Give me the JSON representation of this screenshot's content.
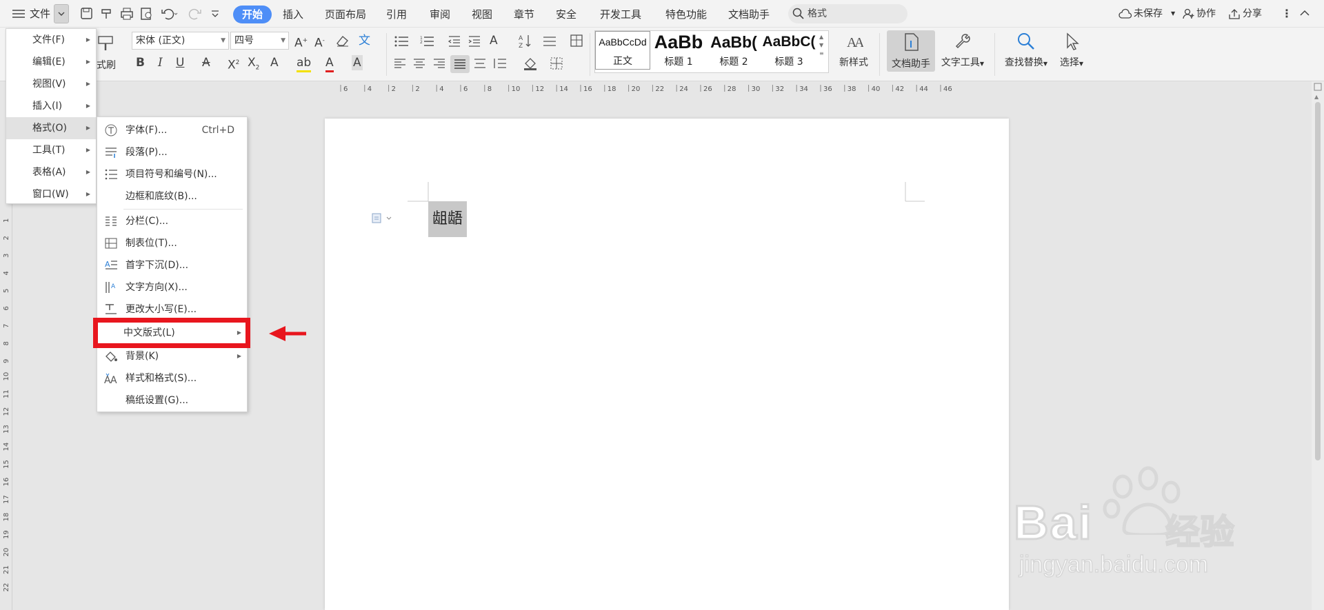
{
  "topbar": {
    "menu_label": "文件",
    "tabs": [
      "开始",
      "插入",
      "页面布局",
      "引用",
      "审阅",
      "视图",
      "章节",
      "安全",
      "开发工具",
      "特色功能",
      "文档助手"
    ],
    "search_placeholder": "格式",
    "unsaved": "未保存",
    "collaborate": "协作",
    "share": "分享"
  },
  "ribbon": {
    "format_painter": "式刷",
    "font_name": "宋体 (正文)",
    "font_size": "四号",
    "styles": [
      {
        "preview": "AaBbCcDd",
        "label": "正文"
      },
      {
        "preview": "AaBb",
        "label": "标题 1"
      },
      {
        "preview": "AaBb(",
        "label": "标题 2"
      },
      {
        "preview": "AaBbC(",
        "label": "标题 3"
      }
    ],
    "new_style": "新样式",
    "doc_assistant": "文档助手",
    "text_tools": "文字工具",
    "find_replace": "查找替换",
    "select": "选择"
  },
  "main_menu": {
    "items": [
      "文件(F)",
      "编辑(E)",
      "视图(V)",
      "插入(I)",
      "格式(O)",
      "工具(T)",
      "表格(A)",
      "窗口(W)"
    ],
    "hovered_index": 4
  },
  "format_submenu": {
    "items": [
      {
        "label": "字体(F)...",
        "shortcut": "Ctrl+D",
        "icon": "font-icon"
      },
      {
        "label": "段落(P)...",
        "icon": "paragraph-icon"
      },
      {
        "label": "项目符号和编号(N)...",
        "icon": "bullet-list-icon"
      },
      {
        "label": "边框和底纹(B)...",
        "icon": ""
      },
      {
        "label": "分栏(C)...",
        "icon": "columns-icon"
      },
      {
        "label": "制表位(T)...",
        "icon": "tab-stop-icon"
      },
      {
        "label": "首字下沉(D)...",
        "icon": "drop-cap-icon"
      },
      {
        "label": "文字方向(X)...",
        "icon": "text-direction-icon"
      },
      {
        "label": "更改大小写(E)...",
        "icon": "change-case-icon"
      },
      {
        "label": "中文版式(L)",
        "icon": "",
        "submenu": true
      },
      {
        "label": "背景(K)",
        "icon": "background-icon",
        "submenu": true
      },
      {
        "label": "样式和格式(S)...",
        "icon": "styles-icon"
      },
      {
        "label": "稿纸设置(G)...",
        "icon": ""
      }
    ],
    "highlighted_index": 9
  },
  "document": {
    "selected_text": "龃龉"
  },
  "ruler": {
    "h_labels": [
      "6",
      "4",
      "2",
      "2",
      "4",
      "6",
      "8",
      "10",
      "12",
      "14",
      "16",
      "18",
      "20",
      "22",
      "24",
      "26",
      "28",
      "30",
      "32",
      "34",
      "36",
      "38",
      "40",
      "42",
      "44",
      "46"
    ],
    "v_labels": [
      "1",
      "2",
      "3",
      "4",
      "5",
      "6",
      "7",
      "8",
      "9",
      "10",
      "11",
      "12",
      "13",
      "14",
      "15",
      "16",
      "17",
      "18",
      "19",
      "20",
      "21",
      "22"
    ]
  },
  "watermark": {
    "brand": "Bai",
    "brand_cn": "经验",
    "url": "jingyan.baidu.com"
  },
  "colors": {
    "accent": "#4e8ef7",
    "highlight_red": "#e8161e"
  }
}
